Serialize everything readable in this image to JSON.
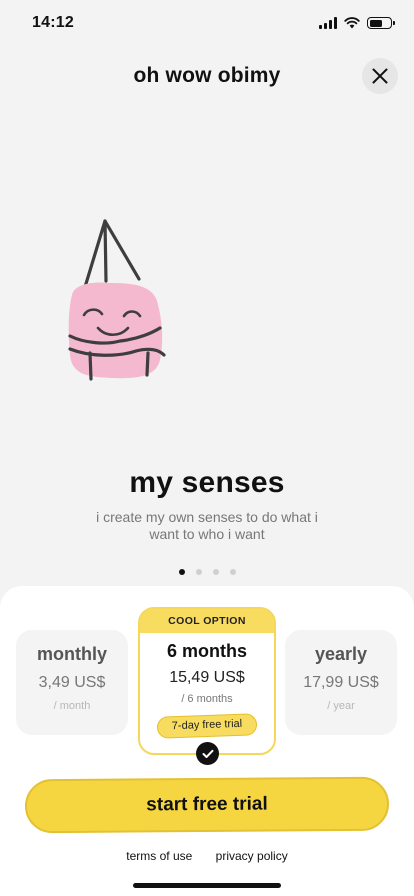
{
  "status_bar": {
    "time": "14:12"
  },
  "header": {
    "title": "oh wow obimy",
    "close_icon": "close-icon"
  },
  "slide": {
    "title": "my senses",
    "subtitle": "i create my own senses to do what i want to who i want",
    "page_count": 4,
    "active_page": 1
  },
  "plans": [
    {
      "name": "monthly",
      "price": "3,49 US$",
      "period": "/ month"
    },
    {
      "badge": "COOL OPTION",
      "name": "6 months",
      "price": "15,49 US$",
      "period": "/ 6 months",
      "trial": "7-day free trial",
      "selected": true
    },
    {
      "name": "yearly",
      "price": "17,99 US$",
      "period": "/ year"
    }
  ],
  "cta": {
    "label": "start free trial"
  },
  "footer": {
    "terms": "terms of use",
    "privacy": "privacy policy"
  },
  "colors": {
    "accent": "#f6d640",
    "background": "#f3f3f3",
    "illustration_pink": "#f4b8cf"
  }
}
